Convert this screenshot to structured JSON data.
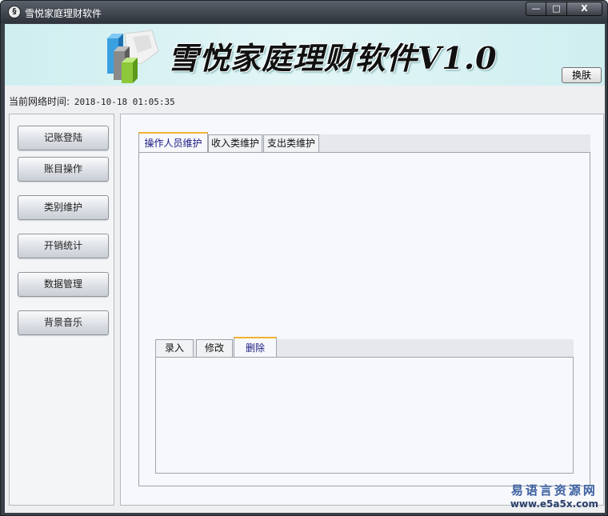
{
  "window": {
    "title": "雪悦家庭理财软件",
    "min_label": "—",
    "max_label": "□",
    "close_label": "X"
  },
  "banner": {
    "title": "雪悦家庭理财软件V1.0",
    "skin_button": "换肤"
  },
  "network_time": {
    "label": "当前网络时间:",
    "value": "2018-10-18 01:05:35"
  },
  "sidebar": {
    "items": [
      {
        "label": "记账登陆"
      },
      {
        "label": "账目操作"
      },
      {
        "label": "类别维护"
      },
      {
        "label": "开销统计"
      },
      {
        "label": "数据管理"
      },
      {
        "label": "背景音乐"
      }
    ]
  },
  "main_tabs": [
    {
      "label": "操作人员维护",
      "active": true
    },
    {
      "label": "收入类维护",
      "active": false
    },
    {
      "label": "支出类维护",
      "active": false
    }
  ],
  "sub_tabs": [
    {
      "label": "录入",
      "active": false
    },
    {
      "label": "修改",
      "active": false
    },
    {
      "label": "删除",
      "active": true
    }
  ],
  "watermark": {
    "line1": "易语言资源网",
    "line2": "www.e5a5x.com"
  },
  "colors": {
    "banner_bg": "#cfeef0",
    "active_tab_accent": "#f2b233",
    "titlebar": "#3a3f48"
  }
}
